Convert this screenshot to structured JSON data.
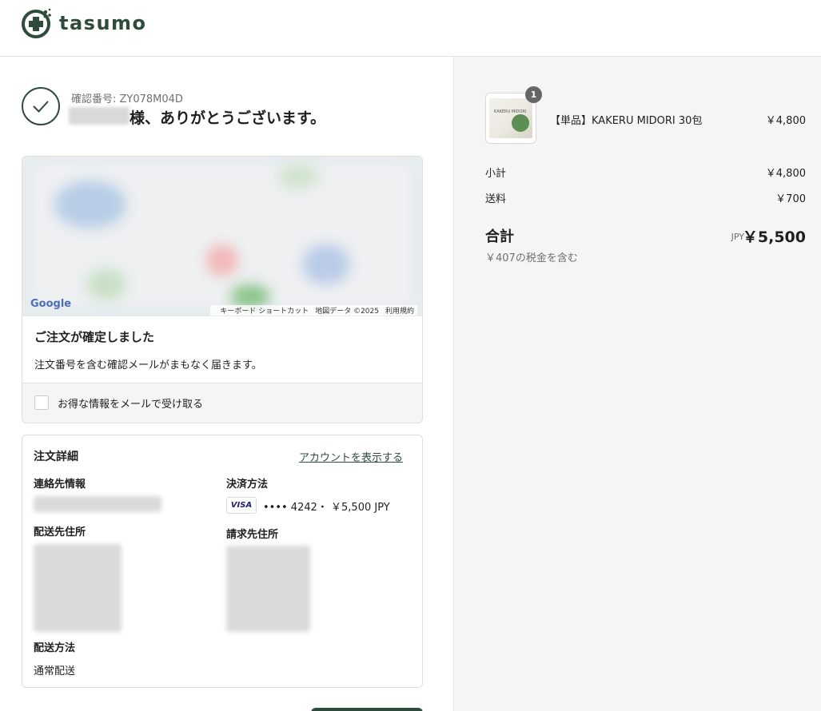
{
  "header": {
    "logo_text": "tasumo"
  },
  "confirmation": {
    "number_label": "確認番号: ZY078M04D",
    "thanks": "様、ありがとうございます。"
  },
  "map": {
    "provider": "Google",
    "footer": [
      "キーボード ショートカット",
      "地図データ ©2025",
      "利用規約"
    ]
  },
  "order_status": {
    "title": "ご注文が確定しました",
    "subtitle": "注文番号を含む確認メールがまもなく届きます。",
    "optin_label": "お得な情報をメールで受け取る",
    "optin_checked": false
  },
  "order_details": {
    "title": "注文詳細",
    "account_link": "アカウントを表示する",
    "contact_label": "連絡先情報",
    "payment_label": "決済方法",
    "card_brand": "VISA",
    "payment_text": "•••• 4242・ ￥5,500 JPY",
    "shipping_address_label": "配送先住所",
    "billing_address_label": "請求先住所",
    "shipping_method_label": "配送方法",
    "shipping_method": "通常配送"
  },
  "summary": {
    "item": {
      "name": "【単品】KAKERU MIDORI 30包",
      "price": "￥4,800",
      "quantity": "1",
      "thumb_text": "KAKERU MIDORI"
    },
    "subtotal_label": "小計",
    "subtotal": "￥4,800",
    "shipping_label": "送料",
    "shipping": "￥700",
    "total_label": "合計",
    "currency": "JPY",
    "total": "￥5,500",
    "tax_note": "￥407の税金を含む"
  },
  "colors": {
    "brand": "#2f4b3c",
    "panel_bg": "#f5f5f5",
    "muted": "#707070"
  }
}
